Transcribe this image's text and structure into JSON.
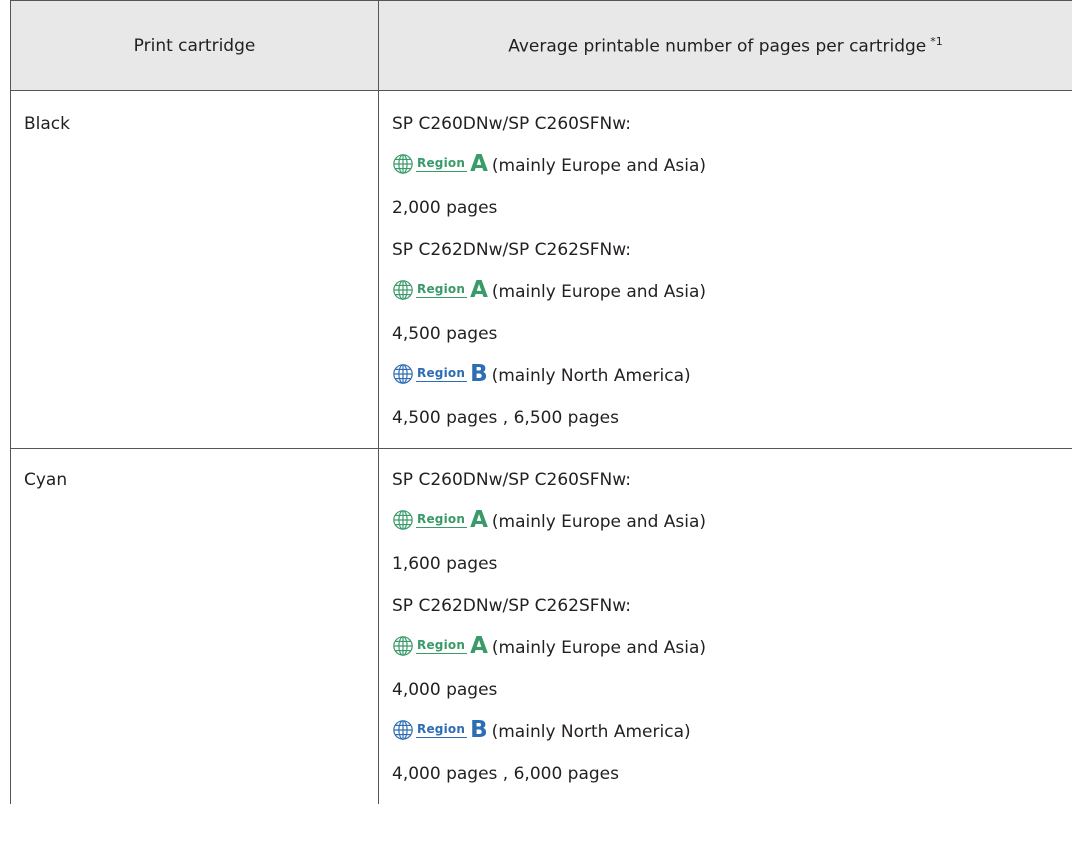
{
  "table": {
    "headers": {
      "col1": "Print cartridge",
      "col2": "Average printable number of pages per cartridge",
      "col2_footnote": "*1"
    },
    "rows": [
      {
        "cartridge": "Black",
        "lines": [
          {
            "type": "text",
            "text": "SP C260DNw/SP C260SFNw:"
          },
          {
            "type": "region",
            "word": "Region",
            "letter": "A",
            "text": "(mainly Europe and Asia)"
          },
          {
            "type": "text",
            "text": "2,000 pages"
          },
          {
            "type": "text",
            "text": "SP C262DNw/SP C262SFNw:"
          },
          {
            "type": "region",
            "word": "Region",
            "letter": "A",
            "text": "(mainly Europe and Asia)"
          },
          {
            "type": "text",
            "text": "4,500 pages"
          },
          {
            "type": "region",
            "word": "Region",
            "letter": "B",
            "text": "(mainly North America)"
          },
          {
            "type": "text",
            "text": "4,500 pages , 6,500 pages"
          }
        ]
      },
      {
        "cartridge": "Cyan",
        "lines": [
          {
            "type": "text",
            "text": "SP C260DNw/SP C260SFNw:"
          },
          {
            "type": "region",
            "word": "Region",
            "letter": "A",
            "text": "(mainly Europe and Asia)"
          },
          {
            "type": "text",
            "text": "1,600 pages"
          },
          {
            "type": "text",
            "text": "SP C262DNw/SP C262SFNw:"
          },
          {
            "type": "region",
            "word": "Region",
            "letter": "A",
            "text": "(mainly Europe and Asia)"
          },
          {
            "type": "text",
            "text": "4,000 pages"
          },
          {
            "type": "region",
            "word": "Region",
            "letter": "B",
            "text": "(mainly North America)"
          },
          {
            "type": "text",
            "text": "4,000 pages , 6,000 pages"
          }
        ]
      }
    ]
  },
  "colors": {
    "region_a": "#3a9a6a",
    "region_b": "#2e6db4",
    "text": "#231f20",
    "header_bg": "#e8e8e8",
    "border": "#555555"
  },
  "icons": {
    "region": "globe-icon"
  }
}
